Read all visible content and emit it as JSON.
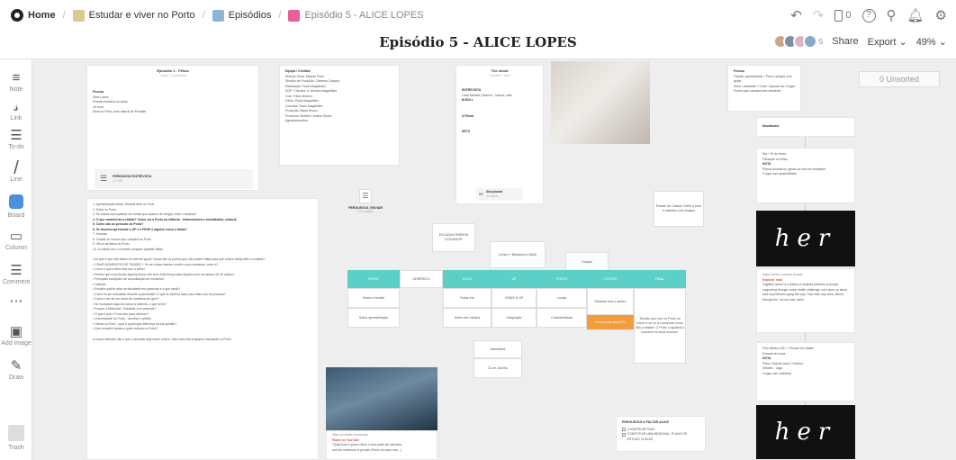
{
  "breadcrumbs": [
    {
      "label": "Home",
      "color": "#222222"
    },
    {
      "label": "Estudar e viver no Porto",
      "color": "#e2c49a"
    },
    {
      "label": "Episódios",
      "color": "#8fb6d0"
    },
    {
      "label": "Episódio 5 - ALICE LOPES",
      "color": "#e85d9a"
    }
  ],
  "page_title": "Episódio 5 - ALICE LOPES",
  "header": {
    "comment_count": "0",
    "avatar_count": "5",
    "share_label": "Share",
    "export_label": "Export",
    "zoom": "49%"
  },
  "toolbar": [
    {
      "label": "Note",
      "icon": "≡"
    },
    {
      "label": "Link",
      "icon": "⛓"
    },
    {
      "label": "To-do",
      "icon": "☑"
    },
    {
      "label": "Line",
      "icon": "/"
    },
    {
      "label": "Board",
      "icon": ""
    },
    {
      "label": "Column",
      "icon": "▭"
    },
    {
      "label": "Comment",
      "icon": "☰"
    },
    {
      "label": "",
      "icon": "⋯"
    },
    {
      "label": "Add image",
      "icon": "🖼"
    },
    {
      "label": "Draw",
      "icon": "✎"
    },
    {
      "label": "Trash",
      "icon": ""
    }
  ],
  "unsorted": "0 Unsorted",
  "cards": {
    "ep1": {
      "title": "Episódio 1 - Filhos",
      "sub": "1 card, 2 comments",
      "lines": [
        "Pessoa",
        "Alice Lopes",
        "Estuda medicina no Icbas",
        "18 anos",
        "Mora no Porto, mas natural de Penafiel"
      ],
      "attachment": "PERGUNTAS ENTREVISTA",
      "att_sub": "2.5 MB"
    },
    "equipa": {
      "lines": [
        "Equipa / Créditos",
        "Direção Geral: Manuel Pinto",
        "Direção de Produção: Catarina Campos",
        "Realização: Paulo Magalhães",
        "DOP / Câmara: A. Moreira Magalhães",
        "Com: Fábio Moreno",
        "Editor: Paulo Magalhães",
        "Colorista: Paulo Magalhães",
        "Produção: Marta Mouro",
        "Produtora: Bubble Creative Studio",
        "Agradecimentos:"
      ]
    },
    "shoot": {
      "title": "The shoot",
      "sub": "1 board, 1 card",
      "lines": [
        "ENTREVISTA",
        "Casa Marieta Catarina - Interior, sala",
        "B-ROLL",
        "",
        "A Filmar",
        "",
        "SETS"
      ],
      "sb": "Storyboard",
      "sb_sub": "16 cards"
    },
    "perguntas_doc": {
      "label": "PERGUNTAS_ENVIAR",
      "sub": "2.0 boards"
    },
    "notes_right1": {
      "lines": [
        "Pessoa",
        "Falada / apresentada + Pais e amigos com ajuda",
        "Setor / Atividade + Onde / quando ser o lugar",
        "Pontos que caracterizam ambiente"
      ]
    },
    "moodboard": {
      "title": "Moodboard"
    },
    "notes_right2": {
      "lines": [
        "Dia + 5ª do Horto",
        "Filmação no Icbas",
        "NOTA",
        "Planos dinâmicos, gerais do sítio da estudante",
        "*Lugar com facsimilidade"
      ]
    },
    "rain": {
      "title": "Explorar mais",
      "lines": [
        "https://vimeo.com/rain-beauty",
        "Together alone in a drama of strained partners of people supporting through social health challenge; who open up about their experiences going the way. How each day went, filmed through the 'Let me lose' video"
      ]
    },
    "notes_right3": {
      "lines": [
        "Pólo Médico HSJ + Pensar da Cidade",
        "Estrada do Icbas",
        "NOTA",
        "Plano: Sala de Aula + Exterior",
        "Detalhe - Lago",
        "*Lugar com sustentar"
      ]
    },
    "questions": {
      "lines": [
        "1. Apresentação inicial: História dele no Porto",
        "2. Sítios no Porto",
        "3. Se fosses acompanhar um turista que acabou de chegar, onde o levarias?",
        "4. O que caracteriza a cidade? Como era o Porto na infância - infraestrutura e mentalidade, cultural.",
        "5. Como são as pessoas do Porto?",
        "6. Se fossses apresentar o UP e o FEUP a alguém como o farias?",
        "7. Hobbies",
        "8. Cidade do mundo que compara ao Porto",
        "9. Ofício da Baixa do Porto",
        "10. Eu ainda dou o conceito preparar questão faltas",
        "",
        "• Ao que é que não sabes no vale em geral? Quais são os pontos que não podem faltar para que a Alice esteja feliz e cuidada?",
        "• CRIAR MOMENTOS DE TENSÃO + Se as coisas tiveram corrido como contaram, como é?",
        "• Como é que a Alice lida com a falha?",
        "• Sentes que a tua ficção alguma forma não tens mais tempo para alguém com um tabaco de 20 soldos?",
        "• Principais condições de consolidação de medicina?",
        "• Hobbies",
        "• Escolha qual te atrai na faculdade em particular e a que razão?",
        "• Como foi ser estudante durante a pandemia? O que se deveria fazer para lidar com as pessoas?",
        "• Como é ser ter um aluno de medicina em gelo?",
        "• Se mudasses alguma coisa no sistema, o que seria?",
        "• Porque a Medicina? Trabalhar com pessoas?",
        "• O que é que o Porto tem para oferecer?",
        "• Universidade do Porto - escolha e opinião",
        "• Lisboa vs Porto - qual é a principal diferença na tua opinião?",
        "• Que conselho darias a quem estuda no Porto?",
        "",
        "A nossa intenção não é que o episódio seja sobre a Alice, mas sobre ela enquanto estudante no Porto."
      ]
    },
    "yt": {
      "lines": [
        "https://youtube.com/shorts",
        "Watch on YouTube",
        "*Quão bom é para o Alice é uma parte da vida dela",
        "and the influencer is private (Tenho um lado meu...)"
      ]
    },
    "perguntas_alice": {
      "title": "PERGUNTAS A FALTAR ALICE",
      "items": [
        "CONSTRUIR FINAL",
        "CONSTITUIR UMA MEDICINA - PLANO DE ESTUDO COM AR"
      ]
    }
  },
  "map": {
    "headers": [
      "INTRO",
      "GENÉRICO",
      "ALICE",
      "UP",
      "PORTO",
      "FUTURO",
      "FINAL"
    ],
    "top_notes": [
      {
        "t": "ESCADAS RIBEIRA ELEVADOR"
      },
      {
        "t": "Centro + Biblioteca ICBAS"
      },
      {
        "t": "Oração"
      },
      {
        "t": "Estado de Cidade Cafés a ciclo e trabalho com amigos"
      }
    ],
    "cells": [
      {
        "t": "Sobre e tensão"
      },
      {
        "t": "Sobre apresentação"
      },
      {
        "t": "Sobre ela"
      },
      {
        "t": "Sobre ser médica"
      },
      {
        "t": "ICBAS E UP"
      },
      {
        "t": "Integração"
      },
      {
        "t": "Locais"
      },
      {
        "t": "Características"
      },
      {
        "t": "Olhando fora e dentro"
      },
      {
        "t": "Ferramenta para PIV"
      },
      {
        "t": "Tensão que vive no Porto no futuro e se vê a conservar como são a cidade. O Porto a ajudará a construir os seus sonhos?"
      },
      {
        "t": "Marselhês"
      },
      {
        "t": "31 de Janeiro"
      }
    ]
  },
  "colors": {
    "teal": "#5ccfc7",
    "orange": "#f39c3c"
  }
}
